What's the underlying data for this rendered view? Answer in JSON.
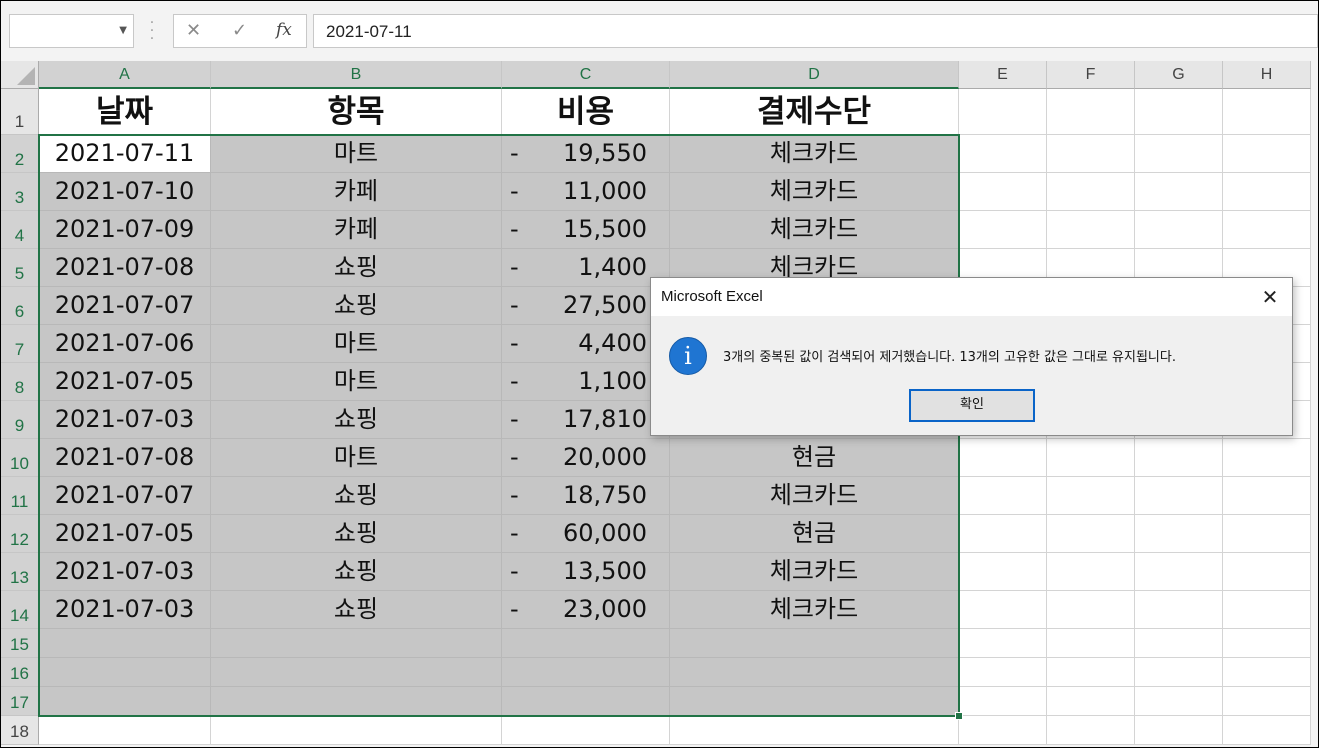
{
  "formula_bar": {
    "name_box_value": "",
    "cancel_glyph": "✕",
    "enter_glyph": "✓",
    "fx_label": "fx",
    "formula_value": "2021-07-11"
  },
  "columns": [
    "A",
    "B",
    "C",
    "D",
    "E",
    "F",
    "G",
    "H"
  ],
  "rows": [
    "1",
    "2",
    "3",
    "4",
    "5",
    "6",
    "7",
    "8",
    "9",
    "10",
    "11",
    "12",
    "13",
    "14",
    "15",
    "16",
    "17",
    "18"
  ],
  "headers": {
    "date": "날짜",
    "item": "항목",
    "cost": "비용",
    "payment": "결제수단"
  },
  "records": [
    {
      "date": "2021-07-11",
      "item": "마트",
      "dash": "-",
      "cost": "19,550",
      "payment": "체크카드"
    },
    {
      "date": "2021-07-10",
      "item": "카페",
      "dash": "-",
      "cost": "11,000",
      "payment": "체크카드"
    },
    {
      "date": "2021-07-09",
      "item": "카페",
      "dash": "-",
      "cost": "15,500",
      "payment": "체크카드"
    },
    {
      "date": "2021-07-08",
      "item": "쇼핑",
      "dash": "-",
      "cost": "1,400",
      "payment": "체크카드"
    },
    {
      "date": "2021-07-07",
      "item": "쇼핑",
      "dash": "-",
      "cost": "27,500",
      "payment": ""
    },
    {
      "date": "2021-07-06",
      "item": "마트",
      "dash": "-",
      "cost": "4,400",
      "payment": ""
    },
    {
      "date": "2021-07-05",
      "item": "마트",
      "dash": "-",
      "cost": "1,100",
      "payment": ""
    },
    {
      "date": "2021-07-03",
      "item": "쇼핑",
      "dash": "-",
      "cost": "17,810",
      "payment": ""
    },
    {
      "date": "2021-07-08",
      "item": "마트",
      "dash": "-",
      "cost": "20,000",
      "payment": "현금"
    },
    {
      "date": "2021-07-07",
      "item": "쇼핑",
      "dash": "-",
      "cost": "18,750",
      "payment": "체크카드"
    },
    {
      "date": "2021-07-05",
      "item": "쇼핑",
      "dash": "-",
      "cost": "60,000",
      "payment": "현금"
    },
    {
      "date": "2021-07-03",
      "item": "쇼핑",
      "dash": "-",
      "cost": "13,500",
      "payment": "체크카드"
    },
    {
      "date": "2021-07-03",
      "item": "쇼핑",
      "dash": "-",
      "cost": "23,000",
      "payment": "체크카드"
    }
  ],
  "dialog": {
    "title": "Microsoft Excel",
    "close_glyph": "✕",
    "icon_glyph": "i",
    "message": "3개의 중복된 값이 검색되어 제거했습니다. 13개의 고유한 값은 그대로 유지됩니다.",
    "ok_label": "확인"
  },
  "colors": {
    "excel_green": "#217346",
    "selection_fill": "#c6c6c6",
    "info_blue": "#1f75d2"
  }
}
